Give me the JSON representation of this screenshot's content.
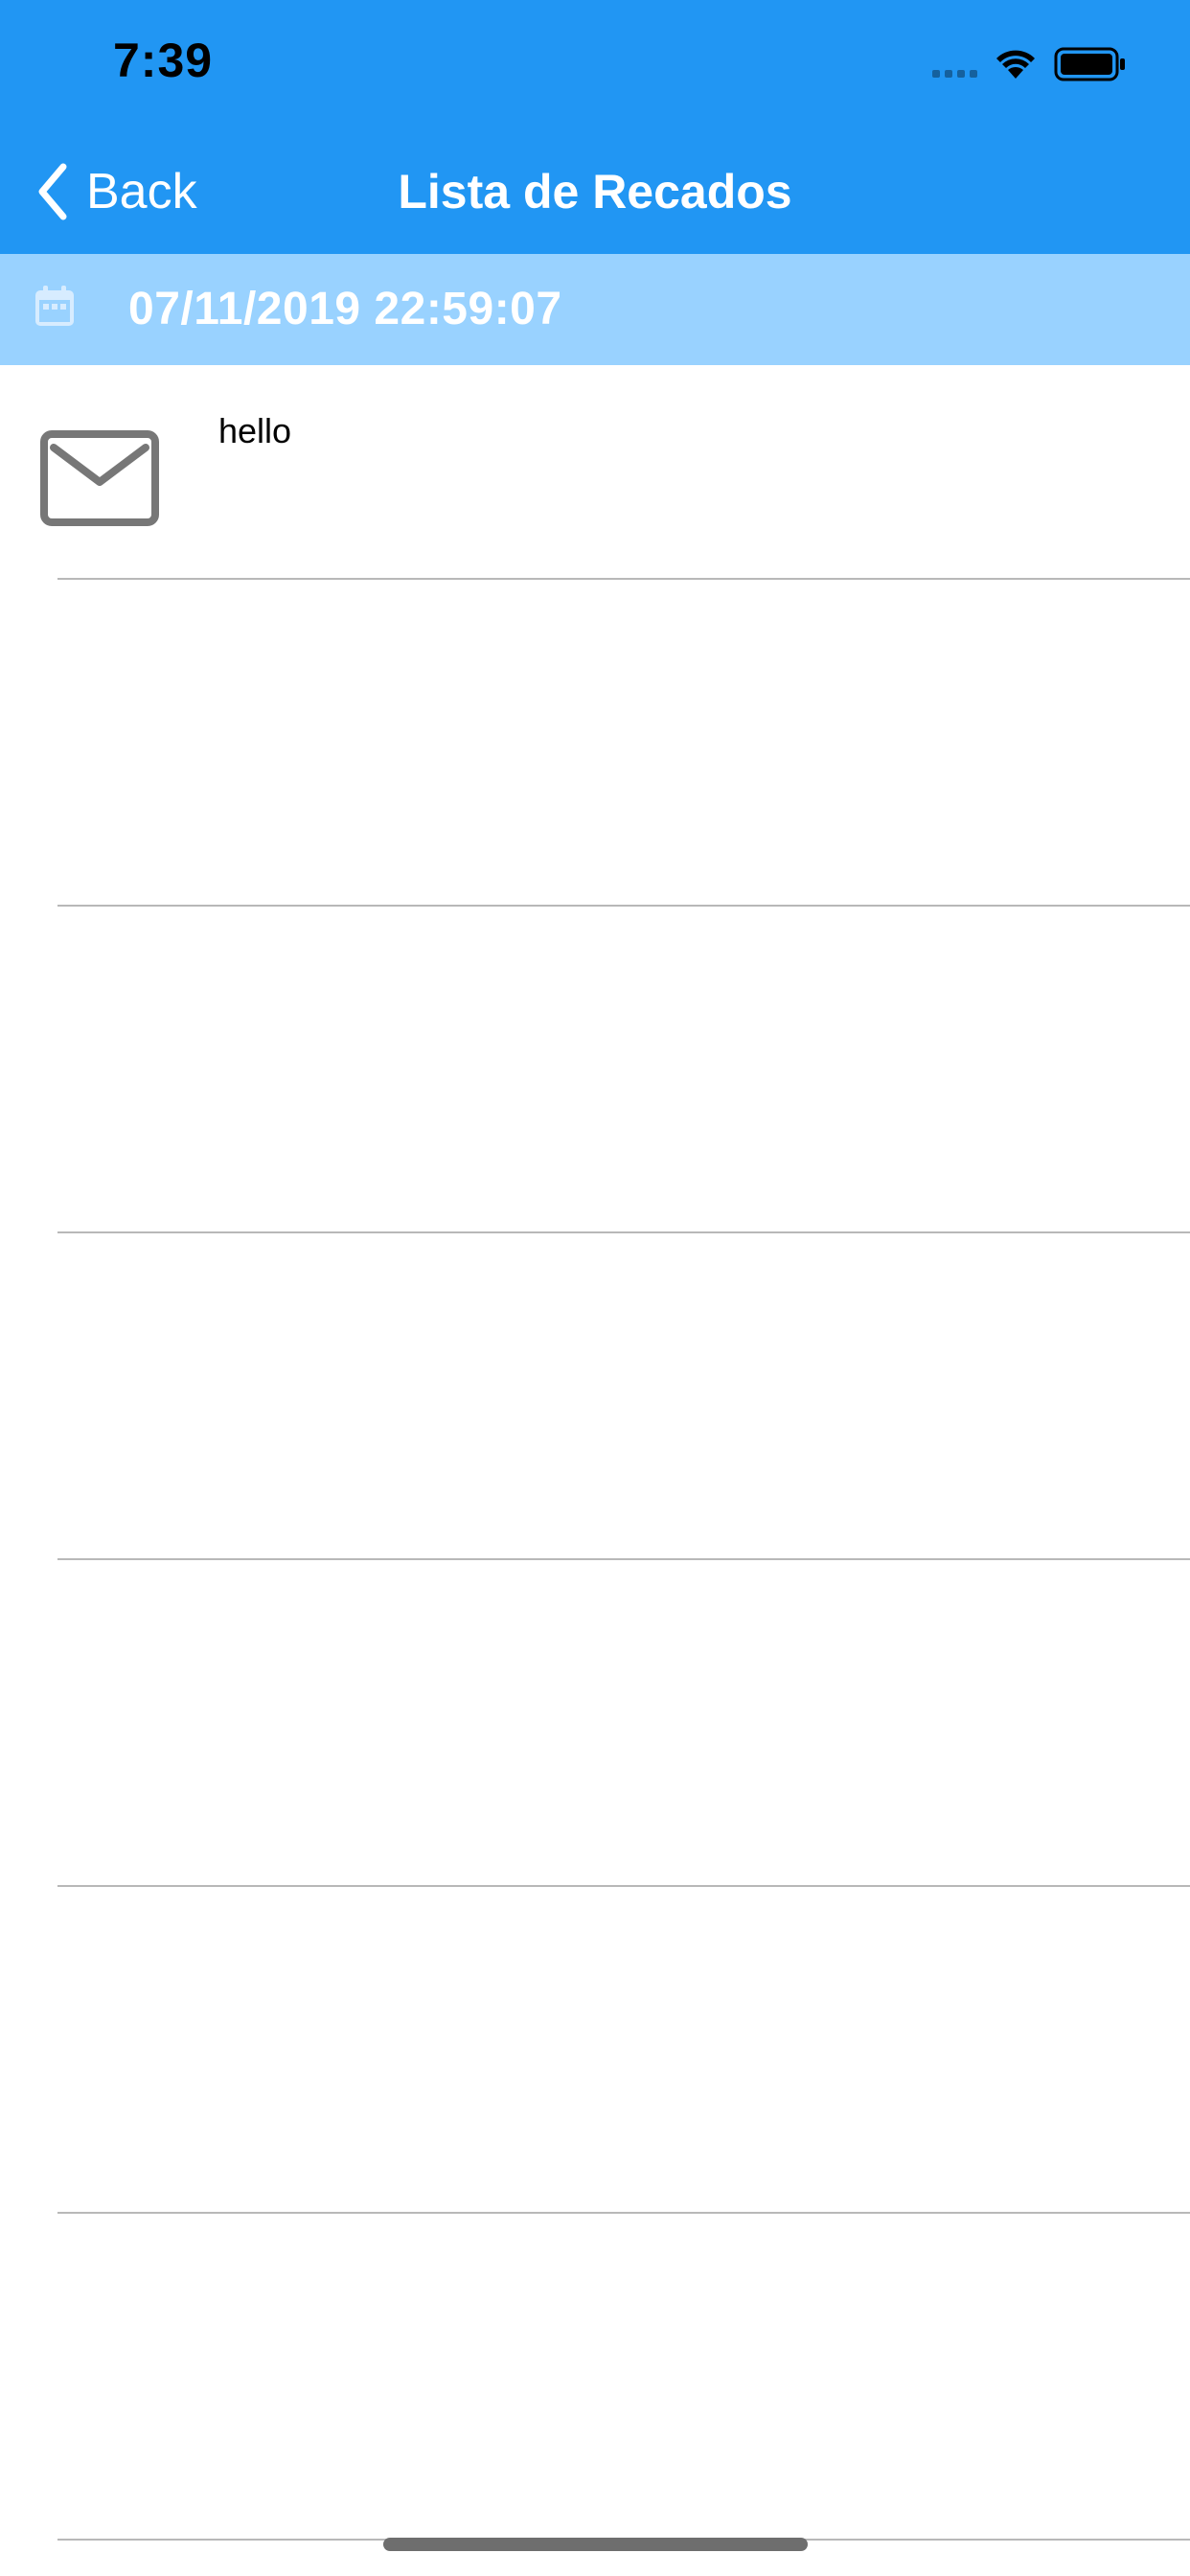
{
  "status_bar": {
    "time": "7:39",
    "icons": [
      "signal-dots-icon",
      "wifi-icon",
      "battery-icon"
    ]
  },
  "nav": {
    "back_label": "Back",
    "back_icon": "chevron-left-icon",
    "title": "Lista de Recados"
  },
  "date_header": {
    "icon": "calendar-icon",
    "text": "07/11/2019 22:59:07"
  },
  "messages": [
    {
      "icon": "mail-icon",
      "text": "hello"
    },
    {
      "text": ""
    },
    {
      "text": ""
    },
    {
      "text": ""
    },
    {
      "text": ""
    },
    {
      "text": ""
    },
    {
      "text": ""
    }
  ],
  "colors": {
    "nav_background": "#2196F3",
    "date_background": "#99D2FF",
    "separator": "#b8b8b8",
    "icon_gray": "#777777"
  }
}
